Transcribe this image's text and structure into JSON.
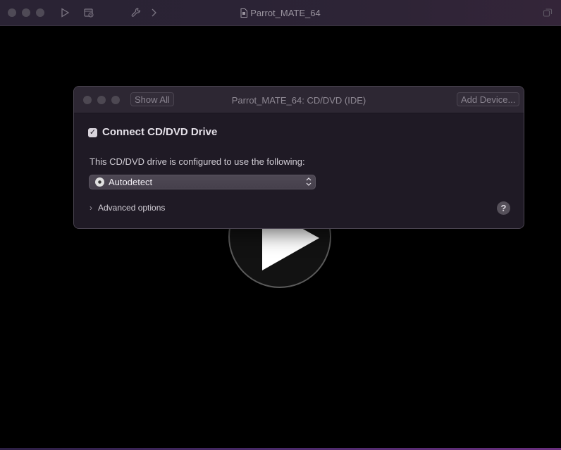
{
  "window": {
    "title": "Parrot_MATE_64"
  },
  "sheet": {
    "title": "Parrot_MATE_64: CD/DVD (IDE)",
    "show_all_label": "Show All",
    "add_device_label": "Add Device...",
    "connect_label": "Connect CD/DVD Drive",
    "connect_checked": true,
    "description": "This CD/DVD drive is configured to use the following:",
    "source_selected": "Autodetect",
    "advanced_label": "Advanced options",
    "help_label": "?"
  },
  "colors": {
    "background": "#000000",
    "titlebar": "#2b2335",
    "sheet": "#201a26",
    "accent_bottom": "#6a2f7e"
  },
  "icons": [
    "play-icon",
    "snapshot-icon",
    "wrench-icon",
    "chevron-right-icon",
    "document-icon",
    "window-restore-icon",
    "cd-disc-icon",
    "chevron-updown-icon",
    "help-icon"
  ]
}
